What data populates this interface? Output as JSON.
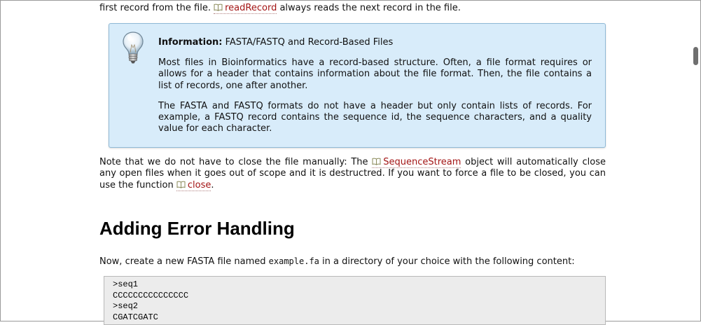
{
  "top_line": {
    "text_before": "first record from the file.",
    "link": "readRecord",
    "text_after": "always reads the next record in the file."
  },
  "info_box": {
    "label": "Information:",
    "title": "FASTA/FASTQ and Record-Based Files",
    "para1": "Most files in Bioinformatics have a record-based structure. Often, a file format requires or allows for a header that contains information about the file format. Then, the file contains a list of records, one after another.",
    "para2": "The FASTA and FASTQ formats do not have a header but only contain lists of records. For example, a FASTQ record contains the sequence id, the sequence characters, and a quality value for each character.",
    "icon": "lightbulb-icon"
  },
  "note": {
    "text1": "Note that we do not have to close the file manually: The",
    "link1": "SequenceStream",
    "text2": "object will automatically close any open files when it goes out of scope and it is destructred. If you want to force a file to be closed, you can use the function",
    "link2": "close",
    "text3": "."
  },
  "section": {
    "heading": "Adding Error Handling"
  },
  "instruction": {
    "text_before": "Now, create a new FASTA file named",
    "filename": "example.fa",
    "text_after": "in a directory of your choice with the following content:"
  },
  "code_block": {
    "content": ">seq1\nCCCCCCCCCCCCCCC\n>seq2\nCGATCGATC"
  },
  "colors": {
    "link": "#a31515",
    "info_bg": "#d8ecfa",
    "info_border": "#8fb9d6",
    "code_bg": "#ececec"
  }
}
